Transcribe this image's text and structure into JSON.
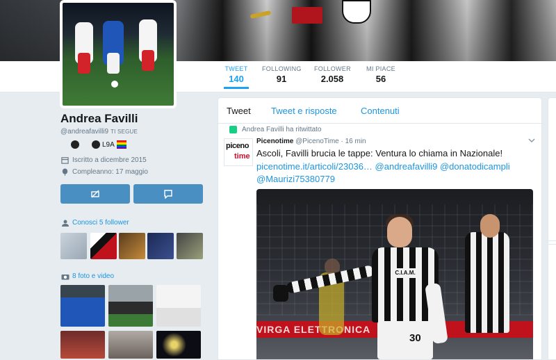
{
  "nav": {
    "stats": [
      {
        "label": "TWEET",
        "value": "140",
        "active": true
      },
      {
        "label": "FOLLOWING",
        "value": "91",
        "active": false
      },
      {
        "label": "FOLLOWER",
        "value": "2.058",
        "active": false
      },
      {
        "label": "MI PIACE",
        "value": "56",
        "active": false
      }
    ]
  },
  "profile": {
    "name": "Andrea Favilli",
    "handle": "@andreafavilli9",
    "follows_you": "TI SEGUE",
    "badge_text": "L9A",
    "joined": "Iscritto a dicembre 2015",
    "birthday": "Compleanno: 17 maggio",
    "known_followers": "Conosci 5 follower",
    "media_title": "8 foto e video"
  },
  "timeline": {
    "tabs": [
      "Tweet",
      "Tweet e risposte",
      "Contenuti"
    ],
    "retweet_label": "Andrea Favilli ha ritwittato",
    "tweet": {
      "author": "Picenotime",
      "author_handle": "@PicenoTime",
      "time": "· 16 min",
      "avatar_line1": "piceno",
      "avatar_line2": "time",
      "text": "Ascoli, Favilli brucia le tappe: Ventura lo chiama in Nazionale!",
      "link1": "picenotime.it/articoli/23036…",
      "mention1": "@andreafavilli9",
      "mention2": "@donatodicampli",
      "mention3": "@Maurizi75380779",
      "media_sponsor": "C.I.A.M.",
      "media_number": "30",
      "media_board": "VIRGA ELETTRONICA"
    }
  },
  "icons": {
    "calendar": "calendar-icon",
    "balloon": "balloon-icon",
    "people": "people-icon",
    "camera": "camera-icon",
    "mute": "mute-icon",
    "message": "message-icon",
    "retweet": "retweet-icon",
    "chevron": "chevron-down-icon"
  },
  "colors": {
    "link": "#1b95e0",
    "accent": "#1da1f2",
    "button": "#4a8fc2",
    "retweet": "#19cf86"
  }
}
